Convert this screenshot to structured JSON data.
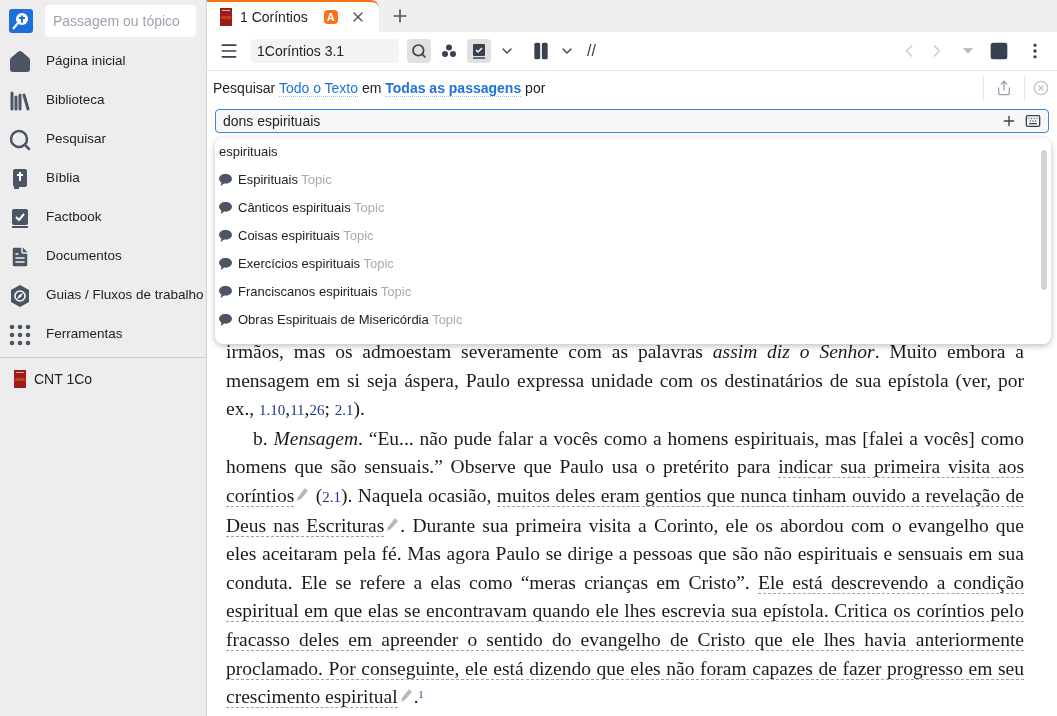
{
  "sidebar": {
    "search": {
      "placeholder": "Passagem ou tópico"
    },
    "items": [
      {
        "label": "Página inicial"
      },
      {
        "label": "Biblioteca"
      },
      {
        "label": "Pesquisar"
      },
      {
        "label": "Bíblia"
      },
      {
        "label": "Factbook"
      },
      {
        "label": "Documentos"
      },
      {
        "label": "Guias / Fluxos de trabalho"
      },
      {
        "label": "Ferramentas"
      }
    ],
    "recent": [
      {
        "label": "CNT 1Co"
      }
    ]
  },
  "tabs": [
    {
      "label": "1 Coríntios",
      "badge": "A",
      "selected": true
    }
  ],
  "toolbar": {
    "reference": "1Coríntios 3.1",
    "parallel_label": "//"
  },
  "search_bar": {
    "prefix": "Pesquisar",
    "scope": "Todo o Texto",
    "middle": "em",
    "range": "Todas as passagens",
    "suffix": "por",
    "query": "dons espirituais"
  },
  "suggestions": [
    {
      "kind": "word",
      "label": "espirituais"
    },
    {
      "kind": "topic",
      "label": "Espirituais",
      "tag": "Topic"
    },
    {
      "kind": "topic",
      "label": "Cânticos espirituais",
      "tag": "Topic"
    },
    {
      "kind": "topic",
      "label": "Coisas espirituais",
      "tag": "Topic"
    },
    {
      "kind": "topic",
      "label": "Exercícios espirituais",
      "tag": "Topic"
    },
    {
      "kind": "topic",
      "label": "Franciscanos espirituais",
      "tag": "Topic"
    },
    {
      "kind": "topic",
      "label": "Obras Espirituais de Misericórdia",
      "tag": "Topic"
    }
  ],
  "paragraphs": [
    {
      "indent": false,
      "segments": [
        {
          "kind": "text",
          "text": "irmãos, mas os admoestam severamente com as palavras "
        },
        {
          "kind": "italic",
          "text": "assim diz o Senhor"
        },
        {
          "kind": "text",
          "text": ". Muito embora a mensagem em si seja áspera, Paulo expressa unidade com os destinatários de sua epístola (ver, por ex., "
        },
        {
          "kind": "ref",
          "text": "1.10"
        },
        {
          "kind": "text",
          "text": ","
        },
        {
          "kind": "ref",
          "text": "11"
        },
        {
          "kind": "text",
          "text": ","
        },
        {
          "kind": "ref",
          "text": "26"
        },
        {
          "kind": "text",
          "text": "; "
        },
        {
          "kind": "ref",
          "text": "2.1"
        },
        {
          "kind": "text",
          "text": ")."
        }
      ]
    },
    {
      "indent": true,
      "segments": [
        {
          "kind": "text",
          "text": "b. "
        },
        {
          "kind": "italic",
          "text": "Mensagem"
        },
        {
          "kind": "text",
          "text": ". “Eu... não pude falar a vocês como a homens espirituais, mas [falei a vocês] como homens que são sensuais.” Observe que Paulo usa o pretérito para "
        },
        {
          "kind": "highlight",
          "text": "indicar sua primeira visita aos coríntios"
        },
        {
          "kind": "text",
          "text": " ("
        },
        {
          "kind": "ref",
          "text": "2.1"
        },
        {
          "kind": "text",
          "text": "). Naquela ocasião, "
        },
        {
          "kind": "highlight",
          "text": "muitos deles eram gentios que nunca tinham ouvido a revelação de Deus nas Escrituras"
        },
        {
          "kind": "text",
          "text": ". Durante sua primeira visita a Corinto, ele os abordou com o evangelho que eles aceitaram pela fé. Mas agora Paulo se dirige a pessoas que são não espirituais e sensuais em sua conduta. Ele se refere a elas como “meras crianças em Cristo”. "
        },
        {
          "kind": "highlight",
          "text": "Ele está descrevendo a condição espiritual em que elas se encontravam quando ele lhes escrevia sua epístola. Critica os coríntios pelo fracasso deles em apreender o sentido do evangelho de Cristo que ele lhes havia anteriormente proclamado. Por conseguinte, ele está dizendo que eles não foram capazes de fazer progresso em seu crescimento espiritual"
        },
        {
          "kind": "text",
          "text": "."
        },
        {
          "kind": "footnote",
          "text": "1"
        }
      ]
    }
  ]
}
